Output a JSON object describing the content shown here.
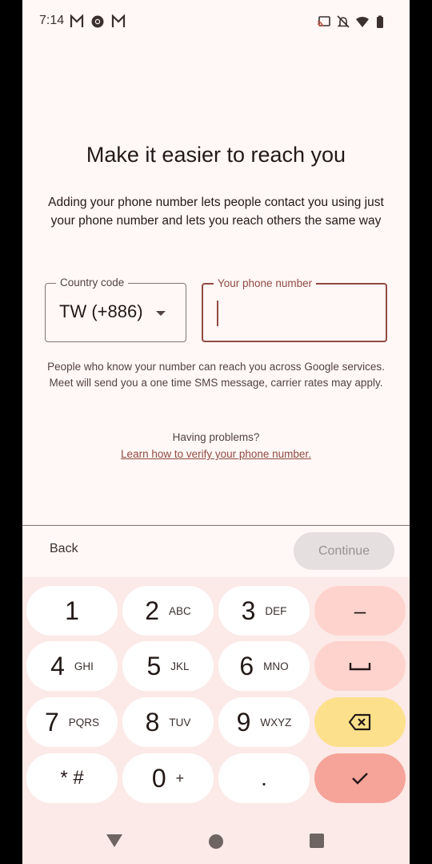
{
  "status_bar": {
    "time": "7:14",
    "left_icons": [
      "gmail-icon",
      "chrome-icon",
      "gmail-icon"
    ],
    "right_icons": [
      "cast-icon",
      "notifications-off-icon",
      "wifi-icon",
      "battery-icon"
    ]
  },
  "page": {
    "title": "Make it easier to reach you",
    "description": "Adding your phone number lets people contact you using just your phone number and lets you reach others the same way",
    "country_code": {
      "label": "Country code",
      "value": "TW (+886)"
    },
    "phone_number": {
      "label": "Your phone number",
      "value": ""
    },
    "note": "People who know your number can reach you across Google services. Meet will send you a one time SMS message, carrier rates may apply.",
    "problems": "Having problems?",
    "learn_link": "Learn how to verify your phone number."
  },
  "footer": {
    "back_label": "Back",
    "continue_label": "Continue",
    "continue_enabled": false
  },
  "keypad": {
    "keys": [
      {
        "digit": "1",
        "letters": ""
      },
      {
        "digit": "2",
        "letters": "ABC"
      },
      {
        "digit": "3",
        "letters": "DEF"
      },
      {
        "digit": "4",
        "letters": "GHI"
      },
      {
        "digit": "5",
        "letters": "JKL"
      },
      {
        "digit": "6",
        "letters": "MNO"
      },
      {
        "digit": "7",
        "letters": "PQRS"
      },
      {
        "digit": "8",
        "letters": "TUV"
      },
      {
        "digit": "9",
        "letters": "WXYZ"
      },
      {
        "digit": "* #",
        "letters": ""
      },
      {
        "digit": "0",
        "letters": "+"
      },
      {
        "digit": ".",
        "letters": ""
      }
    ],
    "side_keys": {
      "minus": "–"
    }
  },
  "colors": {
    "accent": "#904a43",
    "keypad_bg": "#fbeae7",
    "side_key": "#ffd3cd",
    "delete_key": "#fde08b",
    "confirm_key": "#f6a49a"
  }
}
